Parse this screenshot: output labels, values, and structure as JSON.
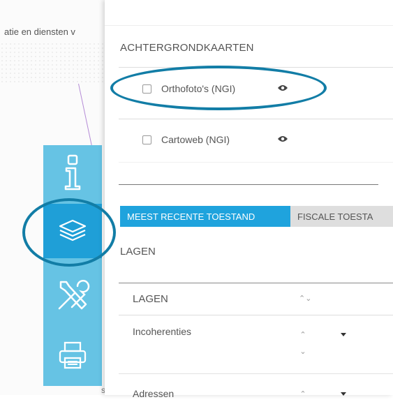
{
  "map": {
    "header_text": "atie en diensten v",
    "bottom_hint": "s"
  },
  "toolbar": {
    "tools": [
      {
        "name": "info",
        "icon": "info-icon"
      },
      {
        "name": "layers",
        "icon": "layers-icon",
        "active": true
      },
      {
        "name": "tools",
        "icon": "wrench-screwdriver-icon"
      },
      {
        "name": "print",
        "icon": "printer-icon"
      }
    ]
  },
  "panel": {
    "background_maps_title": "ACHTERGRONDKAARTEN",
    "background_maps": [
      {
        "label": "Orthofoto's (NGI)",
        "checked": false
      },
      {
        "label": "Cartoweb (NGI)",
        "checked": false
      }
    ],
    "tabs": [
      {
        "label": "MEEST RECENTE TOESTAND",
        "active": true
      },
      {
        "label": "FISCALE TOESTA",
        "active": false
      }
    ],
    "layers_title": "LAGEN",
    "layers_table": {
      "header": "LAGEN",
      "rows": [
        {
          "label": "Incoherenties"
        },
        {
          "label": "Adressen"
        }
      ]
    }
  },
  "colors": {
    "accent": "#1fa3dd",
    "toolbar": "#66c3e4",
    "annotation": "#127da6"
  }
}
